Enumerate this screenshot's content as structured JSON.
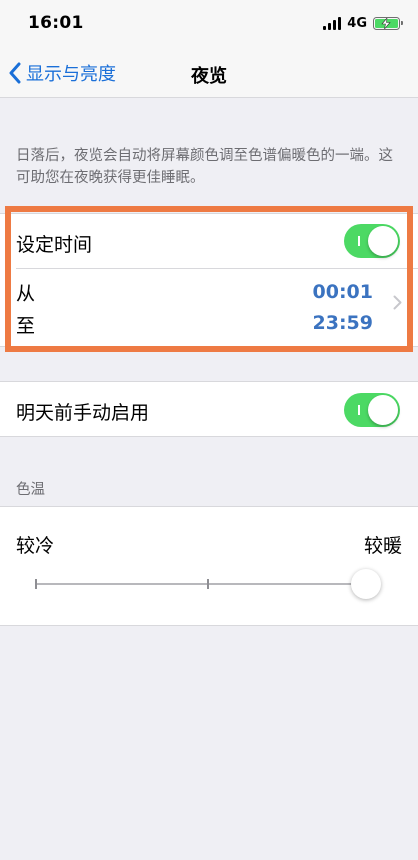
{
  "status_bar": {
    "time": "16:01",
    "network": "4G",
    "battery_fill_pct": 100,
    "battery_color": "#4cd964"
  },
  "nav": {
    "back_label": "显示与亮度",
    "title": "夜览"
  },
  "description": "日落后，夜览会自动将屏幕颜色调至色谱偏暖色的一端。这可助您在夜晚获得更佳睡眠。",
  "schedule": {
    "label": "设定时间",
    "enabled": true,
    "from_label": "从",
    "from_time": "00:01",
    "to_label": "至",
    "to_time": "23:59"
  },
  "manual": {
    "label": "明天前手动启用",
    "enabled": true
  },
  "color_temperature": {
    "header": "色温",
    "cooler_label": "较冷",
    "warmer_label": "较暖",
    "slider_value_fraction": 1.0
  },
  "colors": {
    "accent": "#1a6fd8",
    "toggle_on": "#4cd964",
    "highlight": "#ee7a43",
    "time_text": "#3b73c0"
  }
}
